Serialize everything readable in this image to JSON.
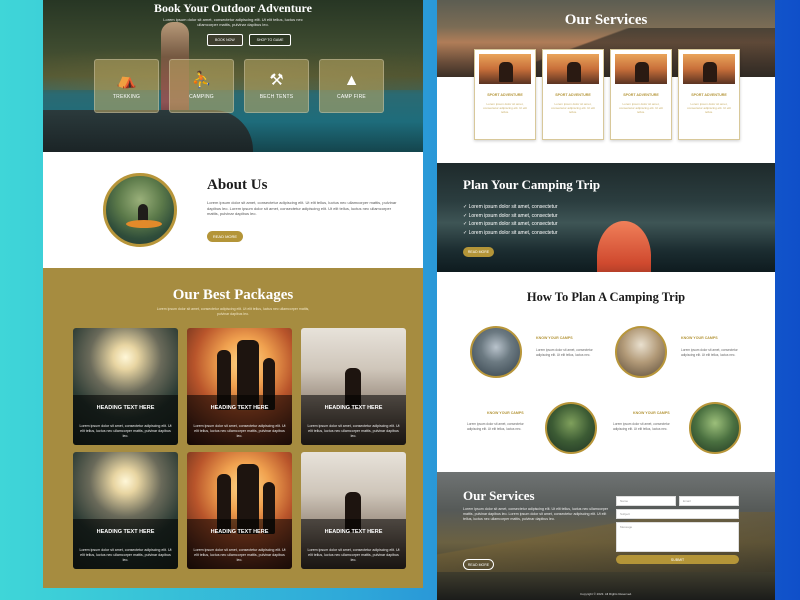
{
  "left": {
    "hero": {
      "title": "Book Your Outdoor Adventure",
      "subtitle": "Lorem ipsum dolor sit amet, consectetur adipiscing elit. Ut elit tellus, luctus nec ullamcorper mattis, pulvinar dapibus leo.",
      "btn_primary": "BOOK NOW",
      "btn_secondary": "SHOP TO GAME",
      "features": [
        {
          "icon": "tent-icon",
          "label": "TREKKING"
        },
        {
          "icon": "campers-icon",
          "label": "CAMPING"
        },
        {
          "icon": "tools-icon",
          "label": "BECH TENTS"
        },
        {
          "icon": "campfire-icon",
          "label": "CAMP FIRE"
        }
      ]
    },
    "about": {
      "title": "About Us",
      "text": "Lorem ipsum dolor sit amet, consectetur adipiscing elit. Ut elit tellus, luctus nec ullamcorper mattis, pulvinar dapibus leo. Lorem ipsum dolor sit amet, consectetur adipiscing elit. Ut elit tellus, luctus nec ullamcorper mattis, pulvinar dapibus leo.",
      "button": "READ MORE"
    },
    "packages": {
      "title": "Our Best Packages",
      "subtitle": "Lorem ipsum dolor sit amet, consectetur adipiscing elit. Ut elit tellus, luctus nec ullamcorper mattis, pulvinar dapibus leo.",
      "cards": [
        {
          "heading": "HEADING TEXT HERE",
          "text": "Lorem ipsum dolor sit amet, consectetur adipiscing elit. Ut elit tellus, luctus nec ullamcorper mattis, pulvinar dapibus leo."
        },
        {
          "heading": "HEADING TEXT HERE",
          "text": "Lorem ipsum dolor sit amet, consectetur adipiscing elit. Ut elit tellus, luctus nec ullamcorper mattis, pulvinar dapibus leo."
        },
        {
          "heading": "HEADING TEXT HERE",
          "text": "Lorem ipsum dolor sit amet, consectetur adipiscing elit. Ut elit tellus, luctus nec ullamcorper mattis, pulvinar dapibus leo."
        },
        {
          "heading": "HEADING TEXT HERE",
          "text": "Lorem ipsum dolor sit amet, consectetur adipiscing elit. Ut elit tellus, luctus nec ullamcorper mattis, pulvinar dapibus leo."
        },
        {
          "heading": "HEADING TEXT HERE",
          "text": "Lorem ipsum dolor sit amet, consectetur adipiscing elit. Ut elit tellus, luctus nec ullamcorper mattis, pulvinar dapibus leo."
        },
        {
          "heading": "HEADING TEXT HERE",
          "text": "Lorem ipsum dolor sit amet, consectetur adipiscing elit. Ut elit tellus, luctus nec ullamcorper mattis, pulvinar dapibus leo."
        }
      ]
    }
  },
  "right": {
    "services_top": {
      "title": "Our Services",
      "cards": [
        {
          "heading": "SPORT ADVENTURE",
          "text": "Lorem ipsum dolor sit amet, consectetur adipiscing elit. Ut elit tellus."
        },
        {
          "heading": "SPORT ADVENTURE",
          "text": "Lorem ipsum dolor sit amet, consectetur adipiscing elit. Ut elit tellus."
        },
        {
          "heading": "SPORT ADVENTURE",
          "text": "Lorem ipsum dolor sit amet, consectetur adipiscing elit. Ut elit tellus."
        },
        {
          "heading": "SPORT ADVENTURE",
          "text": "Lorem ipsum dolor sit amet, consectetur adipiscing elit. Ut elit tellus."
        }
      ]
    },
    "trip": {
      "title": "Plan Your Camping Trip",
      "items": [
        "✓ Lorem ipsum dolor sit amet, consectetur",
        "✓ Lorem ipsum dolor sit amet, consectetur",
        "✓ Lorem ipsum dolor sit amet, consectetur",
        "✓ Lorem ipsum dolor sit amet, consectetur"
      ],
      "button": "READ MORE"
    },
    "plan": {
      "title": "How To Plan A Camping Trip",
      "steps": [
        {
          "heading": "KNOW YOUR CAMPS",
          "text": "Lorem ipsum dolor sit amet, consectetur adipiscing elit. Ut elit tellus, luctus nec."
        },
        {
          "heading": "KNOW YOUR CAMPS",
          "text": "Lorem ipsum dolor sit amet, consectetur adipiscing elit. Ut elit tellus, luctus nec."
        },
        {
          "heading": "KNOW YOUR CAMPS",
          "text": "Lorem ipsum dolor sit amet, consectetur adipiscing elit. Ut elit tellus, luctus nec."
        },
        {
          "heading": "KNOW YOUR CAMPS",
          "text": "Lorem ipsum dolor sit amet, consectetur adipiscing elit. Ut elit tellus, luctus nec."
        }
      ]
    },
    "services_bottom": {
      "title": "Our Services",
      "text": "Lorem ipsum dolor sit amet, consectetur adipiscing elit. Ut elit tellus, luctus nec ullamcorper mattis, pulvinar dapibus leo. Lorem ipsum dolor sit amet, consectetur adipiscing elit. Ut elit tellus, luctus nec ullamcorper mattis, pulvinar dapibus leo.",
      "button": "READ MORE",
      "form": {
        "name_placeholder": "Name",
        "email_placeholder": "Email",
        "subject_placeholder": "Subject",
        "message_placeholder": "Message",
        "submit": "SUBMIT"
      },
      "copyright": "Copyright © 2023. All Rights Reserved."
    }
  },
  "colors": {
    "gold": "#b49538",
    "packages_bg": "#a68c40"
  }
}
